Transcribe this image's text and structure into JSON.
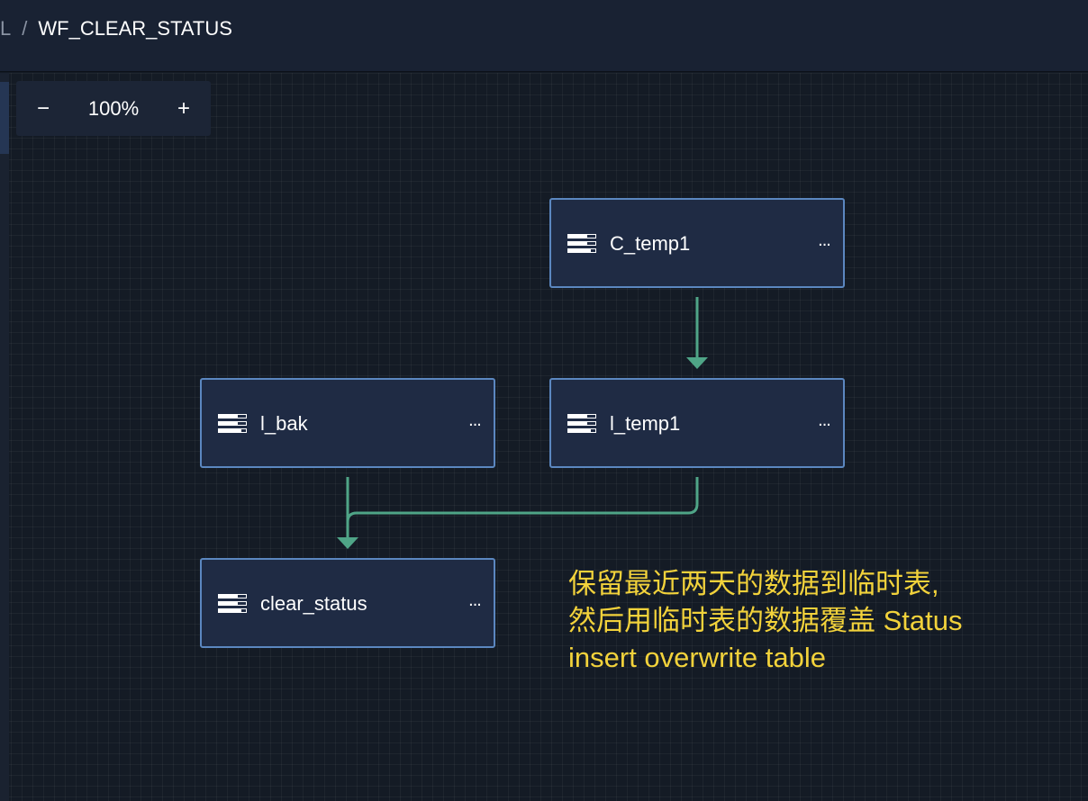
{
  "header": {
    "breadcrumb_prev": "L",
    "separator": "/",
    "title": "WF_CLEAR_STATUS"
  },
  "zoom": {
    "minus_label": "−",
    "value": "100%",
    "plus_label": "+"
  },
  "nodes": [
    {
      "label": "C_temp1",
      "icon": "table-icon",
      "more": "..."
    },
    {
      "label": "l_bak",
      "icon": "table-icon",
      "more": "..."
    },
    {
      "label": "l_temp1",
      "icon": "table-icon",
      "more": "..."
    },
    {
      "label": "clear_status",
      "icon": "table-icon",
      "more": "..."
    }
  ],
  "edges": [
    {
      "from": "C_temp1",
      "to": "l_temp1"
    },
    {
      "from": "l_bak",
      "to": "clear_status"
    },
    {
      "from": "l_temp1",
      "to": "clear_status"
    }
  ],
  "annotation": {
    "lines": [
      "保留最近两天的数据到临时表,",
      "然后用临时表的数据覆盖 Status",
      "insert overwrite table"
    ]
  },
  "colors": {
    "edge": "#4fa587",
    "node_border": "#5b87c0",
    "annotation": "#f2d23b"
  }
}
